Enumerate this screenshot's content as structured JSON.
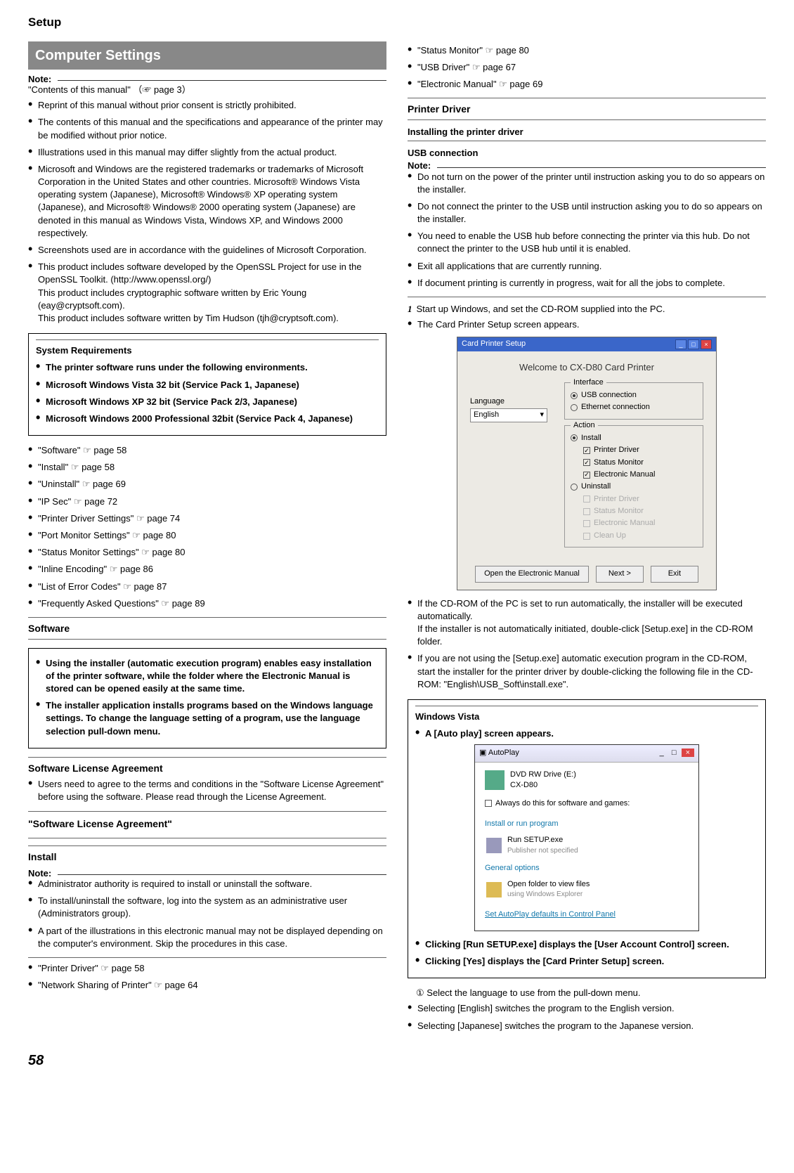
{
  "pageHeader": "Setup",
  "pageNumber": "58",
  "sectionTitle": "Computer Settings",
  "noteLabel": "Note:",
  "contentsRef": "\"Contents of this manual\" （☞ page 3）",
  "manualNotes": [
    "Reprint of this manual without prior consent is strictly prohibited.",
    "The contents of this manual and the specifications and appearance of the printer may be modified without prior notice.",
    "Illustrations used in this manual may differ slightly from the actual product.",
    "Microsoft and Windows are the registered trademarks or trademarks of Microsoft Corporation in the United States and other countries. Microsoft® Windows Vista operating system (Japanese), Microsoft® Windows® XP operating system (Japanese), and Microsoft® Windows® 2000 operating system (Japanese) are denoted in this manual as Windows Vista, Windows XP, and Windows 2000 respectively.",
    "Screenshots used are in accordance with the guidelines of Microsoft Corporation.",
    "This product includes software developed by the OpenSSL Project for use in the OpenSSL Toolkit. (http://www.openssl.org/)\nThis product includes cryptographic software written by Eric Young (eay@cryptsoft.com).\nThis product includes software written by Tim Hudson (tjh@cryptsoft.com)."
  ],
  "sysReq": {
    "title": "System Requirements",
    "intro": "The printer software runs under the following environments.",
    "items": [
      "Microsoft Windows Vista 32 bit (Service Pack 1, Japanese)",
      "Microsoft Windows XP 32 bit (Service Pack 2/3, Japanese)",
      "Microsoft Windows 2000 Professional 32bit (Service Pack 4, Japanese)"
    ]
  },
  "tocLinks": [
    "\"Software\" ☞ page 58",
    "\"Install\" ☞ page 58",
    "\"Uninstall\" ☞ page 69",
    "\"IP Sec\" ☞ page 72",
    "\"Printer Driver Settings\" ☞ page 74",
    "\"Port Monitor Settings\" ☞ page 80",
    "\"Status Monitor Settings\" ☞ page 80",
    "\"Inline Encoding\" ☞ page 86",
    "\"List of Error Codes\" ☞ page 87",
    "\"Frequently Asked Questions\" ☞ page 89"
  ],
  "softwareHead": "Software",
  "softwareBox": [
    "Using the installer (automatic execution program) enables easy installation of the printer software, while the folder where the Electronic Manual is stored can be opened easily at the same time.",
    "The installer application installs programs based on the Windows language settings. To change the language setting of a program, use the language selection pull-down menu."
  ],
  "slaHead": "Software License Agreement",
  "slaText": "Users need to agree to the terms and conditions in the \"Software License Agreement\" before using the software. Please read through the License Agreement.",
  "slaQuote": "\"Software License Agreement\"",
  "installHead": "Install",
  "installNotes": [
    "Administrator authority is required to install or uninstall the software.",
    "To install/uninstall the software, log into the system as an administrative user (Administrators group).",
    "A part of the illustrations in this electronic manual may not be displayed depending on the computer's environment. Skip the procedures in this case."
  ],
  "installLinks": [
    "\"Printer Driver\" ☞ page 58",
    "\"Network Sharing of Printer\" ☞ page 64"
  ],
  "col2TopLinks": [
    "\"Status Monitor\" ☞ page 80",
    "\"USB Driver\" ☞ page 67",
    "\"Electronic Manual\" ☞ page 69"
  ],
  "printerDriverHead": "Printer Driver",
  "installingHead": "Installing the printer driver",
  "usbHead": "USB connection",
  "usbNotes": [
    "Do not turn on the power of the printer until instruction asking you to do so appears on the installer.",
    "Do not connect the printer to the USB until instruction asking you to do so appears on the installer.",
    "You need to enable the USB hub before connecting the printer via this hub. Do not connect the printer to the USB hub until it is enabled.",
    "Exit all applications that are currently running.",
    "If document printing is currently in progress, wait for all the jobs to complete."
  ],
  "step1": {
    "num": "1",
    "text": "Start up Windows, and set the CD-ROM supplied into the PC."
  },
  "step1sub": "The Card Printer Setup screen appears.",
  "installer": {
    "title": "Card Printer Setup",
    "welcome": "Welcome to CX-D80 Card Printer",
    "interfaceLegend": "Interface",
    "ifUsb": "USB connection",
    "ifEth": "Ethernet connection",
    "actionLegend": "Action",
    "actInstall": "Install",
    "actPD": "Printer Driver",
    "actSM": "Status Monitor",
    "actEM": "Electronic Manual",
    "actUninstall": "Uninstall",
    "unPD": "Printer Driver",
    "unSM": "Status Monitor",
    "unEM": "Electronic Manual",
    "unCU": "Clean Up",
    "langLabel": "Language",
    "langValue": "English",
    "btnManual": "Open the Electronic Manual",
    "btnNext": "Next >",
    "btnExit": "Exit"
  },
  "afterInstaller": [
    "If the CD-ROM of the PC is set to run automatically, the installer will be executed automatically.\nIf the installer is not automatically initiated, double-click [Setup.exe] in the CD-ROM folder.",
    "If you are not using the [Setup.exe] automatic execution program in the CD-ROM, start the installer for the printer driver by double-clicking the following file in the CD-ROM: \"English\\USB_Soft\\install.exe\"."
  ],
  "vista": {
    "head": "Windows Vista",
    "line1": "A [Auto play] screen appears.",
    "apTitle": "AutoPlay",
    "drive1": "DVD RW Drive (E:)",
    "drive2": "CX-D80",
    "always": "Always do this for software and games:",
    "sec1": "Install or run program",
    "runSetup": "Run SETUP.exe",
    "pubNot": "Publisher not specified",
    "sec2": "General options",
    "openFolder": "Open folder to view files",
    "usingExplorer": "using Windows Explorer",
    "setDefaults": "Set AutoPlay defaults in Control Panel",
    "line2": "Clicking [Run SETUP.exe] displays the [User Account Control] screen.",
    "line3": "Clicking [Yes] displays the [Card Printer Setup] screen."
  },
  "langStep": {
    "circ": "①",
    "text": "Select the language to use from the pull-down menu.",
    "en": "Selecting [English] switches the program to the English version.",
    "jp": "Selecting [Japanese] switches the program to the Japanese version."
  }
}
